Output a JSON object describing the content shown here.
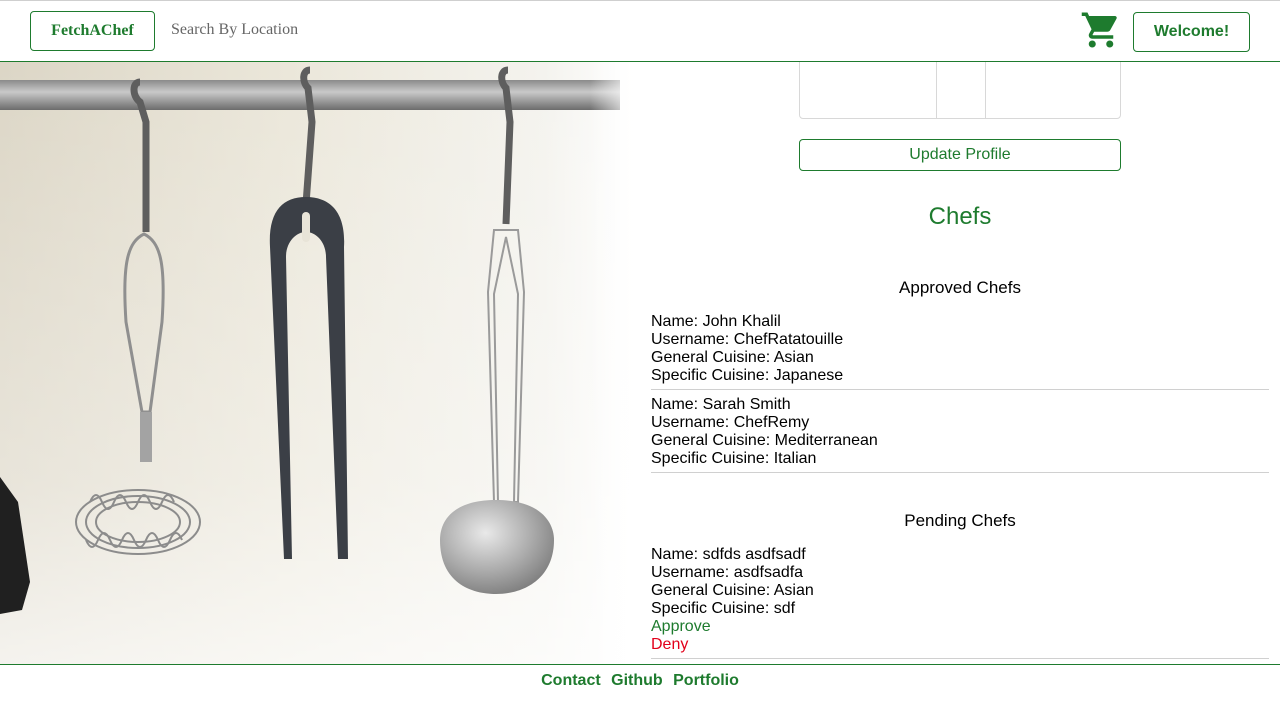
{
  "header": {
    "brand": "FetchAChef",
    "search_placeholder": "Search By Location",
    "cart_icon": "shopping-cart-icon",
    "welcome_label": "Welcome!"
  },
  "profile": {
    "update_label": "Update Profile"
  },
  "chefs": {
    "title": "Chefs",
    "approved_title": "Approved Chefs",
    "approved": [
      {
        "name": "Name: John Khalil",
        "username": "Username: ChefRatatouille",
        "general": "General Cuisine: Asian",
        "specific": "Specific Cuisine: Japanese"
      },
      {
        "name": "Name: Sarah Smith",
        "username": "Username: ChefRemy",
        "general": "General Cuisine: Mediterranean",
        "specific": "Specific Cuisine: Italian"
      }
    ],
    "pending_title": "Pending Chefs",
    "pending": [
      {
        "name": "Name: sdfds asdfsadf",
        "username": "Username: asdfsadfa",
        "general": "General Cuisine: Asian",
        "specific": "Specific Cuisine: sdf",
        "approve_label": "Approve",
        "deny_label": "Deny"
      }
    ]
  },
  "footer": {
    "links": [
      "Contact",
      "Github",
      "Portfolio"
    ]
  },
  "colors": {
    "brand_green": "#1e7b2e",
    "deny_red": "#e2001a"
  }
}
